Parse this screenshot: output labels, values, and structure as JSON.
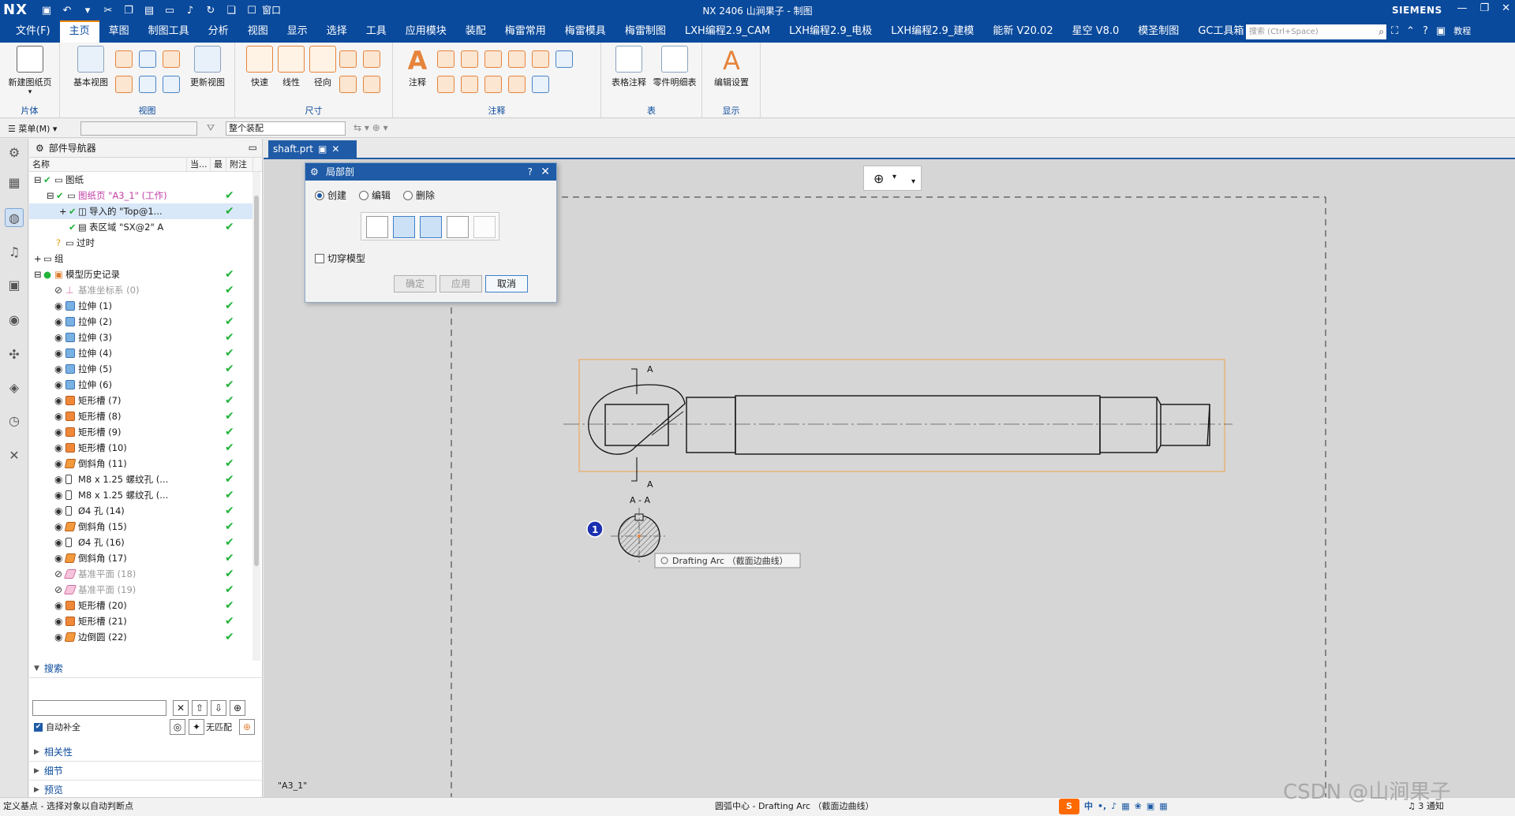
{
  "titlebar": {
    "logo": "NX",
    "title": "NX 2406 山涧果子 - 制图",
    "window_menu": "窗口",
    "brand": "SIEMENS"
  },
  "menubar": {
    "items": [
      "文件(F)",
      "主页",
      "草图",
      "制图工具",
      "分析",
      "视图",
      "显示",
      "选择",
      "工具",
      "应用模块",
      "装配",
      "梅雷常用",
      "梅雷模具",
      "梅雷制图",
      "LXH编程2.9_CAM",
      "LXH编程2.9_电极",
      "LXH编程2.9_建模",
      "能新 V20.02",
      "星空 V8.0",
      "模圣制图",
      "GC工具箱"
    ],
    "active_index": 1,
    "search_placeholder": "搜索 (Ctrl+Space)",
    "tutorial": "教程"
  },
  "ribbon": {
    "groups": {
      "sheet": "片体",
      "view": "视图",
      "dimension": "尺寸",
      "annotation": "注释",
      "table": "表",
      "display": "显示"
    },
    "buttons": {
      "new_sheet": "新建图纸页",
      "base_view": "基本视图",
      "update_view": "更新视图",
      "rapid": "快速",
      "linear": "线性",
      "radial": "径向",
      "note": "注释",
      "tabular_note": "表格注释",
      "parts_list": "零件明细表",
      "edit_settings": "编辑设置"
    }
  },
  "toolbar2": {
    "menu": "菜单(M)",
    "filter_combo": "",
    "scope_combo": "整个装配"
  },
  "navigator": {
    "title": "部件导航器",
    "columns": [
      "名称",
      "当...",
      "最",
      "附注"
    ],
    "rows": [
      {
        "label": "图纸",
        "style": "normal"
      },
      {
        "label": "图纸页 \"A3_1\" (工作)",
        "style": "pink"
      },
      {
        "label": "导入的 \"Top@1...",
        "style": "normal"
      },
      {
        "label": "表区域 \"SX@2\" A",
        "style": "normal"
      },
      {
        "label": "过时",
        "style": "normal"
      },
      {
        "label": "组",
        "style": "normal"
      },
      {
        "label": "模型历史记录",
        "style": "normal"
      },
      {
        "label": "基准坐标系 (0)",
        "style": "muted"
      },
      {
        "label": "拉伸 (1)",
        "style": "normal"
      },
      {
        "label": "拉伸 (2)",
        "style": "normal"
      },
      {
        "label": "拉伸 (3)",
        "style": "normal"
      },
      {
        "label": "拉伸 (4)",
        "style": "normal"
      },
      {
        "label": "拉伸 (5)",
        "style": "normal"
      },
      {
        "label": "拉伸 (6)",
        "style": "normal"
      },
      {
        "label": "矩形槽 (7)",
        "style": "normal"
      },
      {
        "label": "矩形槽 (8)",
        "style": "normal"
      },
      {
        "label": "矩形槽 (9)",
        "style": "normal"
      },
      {
        "label": "矩形槽 (10)",
        "style": "normal"
      },
      {
        "label": "倒斜角 (11)",
        "style": "normal"
      },
      {
        "label": "M8 x 1.25 螺纹孔 (...",
        "style": "normal"
      },
      {
        "label": "M8 x 1.25 螺纹孔 (...",
        "style": "normal"
      },
      {
        "label": "Ø4 孔 (14)",
        "style": "normal"
      },
      {
        "label": "倒斜角 (15)",
        "style": "normal"
      },
      {
        "label": "Ø4 孔 (16)",
        "style": "normal"
      },
      {
        "label": "倒斜角 (17)",
        "style": "normal"
      },
      {
        "label": "基准平面 (18)",
        "style": "muted"
      },
      {
        "label": "基准平面 (19)",
        "style": "muted"
      },
      {
        "label": "矩形槽 (20)",
        "style": "normal"
      },
      {
        "label": "矩形槽 (21)",
        "style": "normal"
      },
      {
        "label": "边倒圆 (22)",
        "style": "normal"
      }
    ],
    "search_section": "搜索",
    "auto_complete": "自动补全",
    "no_match": "无匹配",
    "sections": [
      "相关性",
      "细节",
      "预览"
    ]
  },
  "document": {
    "tab": "shaft.prt",
    "sheet_label": "\"A3_1\""
  },
  "dialog": {
    "title": "局部剖",
    "modes": [
      "创建",
      "编辑",
      "删除"
    ],
    "selected_mode": 0,
    "cut_model": "切穿模型",
    "ok": "确定",
    "apply": "应用",
    "cancel": "取消"
  },
  "drawing": {
    "section_marker_top": "A",
    "section_marker_bottom": "A",
    "section_view_label": "A - A",
    "badge": "1",
    "tooltip": "Drafting Arc （截面边曲线）"
  },
  "statusbar": {
    "left": "定义基点 - 选择对象以自动判断点",
    "center": "圆弧中心 - Drafting Arc （截面边曲线）",
    "ime": "中",
    "notifications": "3 通知"
  },
  "watermark": "CSDN @山涧果子",
  "colors": {
    "brand_blue": "#0a4a9c",
    "accent_orange": "#ff8a00",
    "check_green": "#22b33a",
    "canvas_gray": "#d6d6d6"
  }
}
